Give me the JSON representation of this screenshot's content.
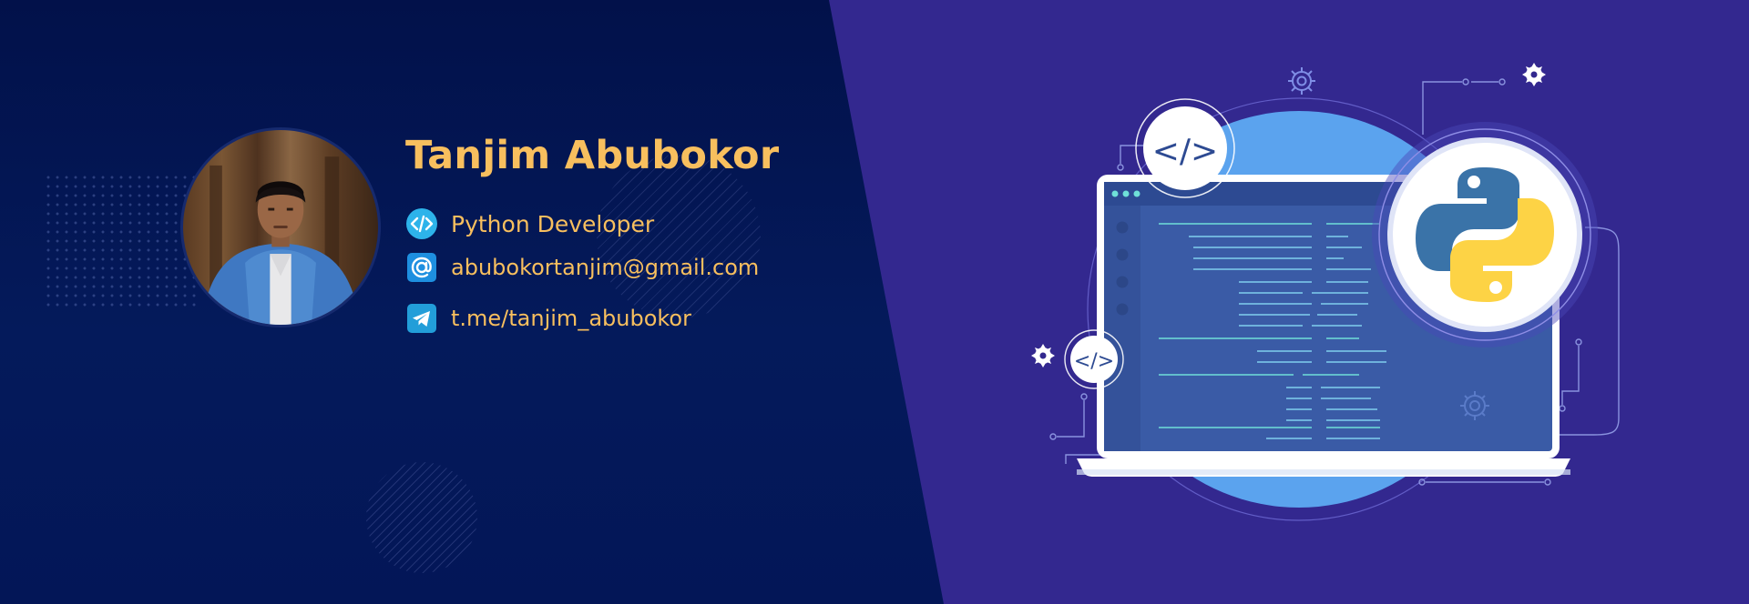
{
  "profile": {
    "name": "Tanjim Abubokor",
    "role": "Python Developer",
    "email": "abubokortanjim@gmail.com",
    "telegram": "t.me/tanjim_abubokor"
  },
  "illustration": {
    "code_tag": "</>"
  },
  "colors": {
    "left_background": "#031657",
    "right_background": "#33288f",
    "accent_text": "#f8bf5e",
    "circle_blue": "#5ba3ee",
    "screen_blue": "#3a5ba6",
    "python_blue": "#3a73a8",
    "python_yellow": "#fdd345"
  },
  "icons": {
    "role": "code-icon",
    "email": "at-sign-icon",
    "telegram": "telegram-icon"
  }
}
